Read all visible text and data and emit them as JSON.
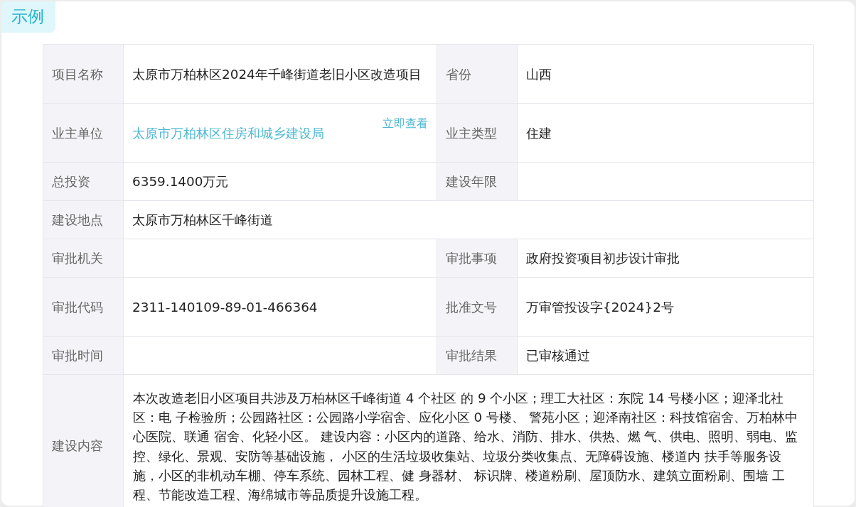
{
  "tag": "示例",
  "rows": [
    {
      "cells": [
        {
          "label": "项目名称",
          "value": "太原市万柏林区2024年千峰街道老旧小区改造项目",
          "kind": "text"
        },
        {
          "label": "省份",
          "value": "山西",
          "kind": "text"
        }
      ]
    },
    {
      "cells": [
        {
          "label": "业主单位",
          "value": "太原市万柏林区住房和城乡建设局",
          "kind": "link",
          "action": "立即查看"
        },
        {
          "label": "业主类型",
          "value": "住建",
          "kind": "text"
        }
      ]
    },
    {
      "cells": [
        {
          "label": "总投资",
          "value": "6359.1400万元",
          "kind": "text"
        },
        {
          "label": "建设年限",
          "kind": "text"
        }
      ]
    },
    {
      "cells": [
        {
          "label": "建设地点",
          "value": "太原市万柏林区千峰街道",
          "kind": "text"
        }
      ]
    },
    {
      "cells": [
        {
          "label": "审批机关",
          "kind": "text"
        },
        {
          "label": "审批事项",
          "value": "政府投资项目初步设计审批",
          "kind": "text"
        }
      ]
    },
    {
      "cells": [
        {
          "label": "审批代码",
          "value": "2311-140109-89-01-466364",
          "kind": "text"
        },
        {
          "label": "批准文号",
          "value": "万审管投设字{2024}2号",
          "kind": "text"
        }
      ]
    },
    {
      "cells": [
        {
          "label": "审批时间",
          "kind": "text"
        },
        {
          "label": "审批结果",
          "value": "已审核通过",
          "kind": "text"
        }
      ]
    },
    {
      "cells": [
        {
          "label": "建设内容",
          "value": "本次改造老旧小区项目共涉及万柏林区千峰街道 4 个社区 的 9 个小区；理工大社区：东院 14 号楼小区；迎泽北社区：电 子检验所；公园路社区：公园路小学宿舍、应化小区 0 号楼、 警苑小区；迎泽南社区：科技馆宿舍、万柏林中心医院、联通 宿舍、化轻小区。 建设内容：小区内的道路、给水、消防、排水、供热、燃 气、供电、照明、弱电、监控、绿化、景观、安防等基础设施， 小区的生活垃圾收集站、垃圾分类收集点、无障碍设施、楼道内 扶手等服务设施，小区的非机动车棚、停车系统、园林工程、健 身器材、 标识牌、楼道粉刷、屋顶防水、建筑立面粉刷、围墙 工程、节能改造工程、海绵城市等品质提升设施工程。",
          "kind": "text"
        }
      ]
    }
  ]
}
